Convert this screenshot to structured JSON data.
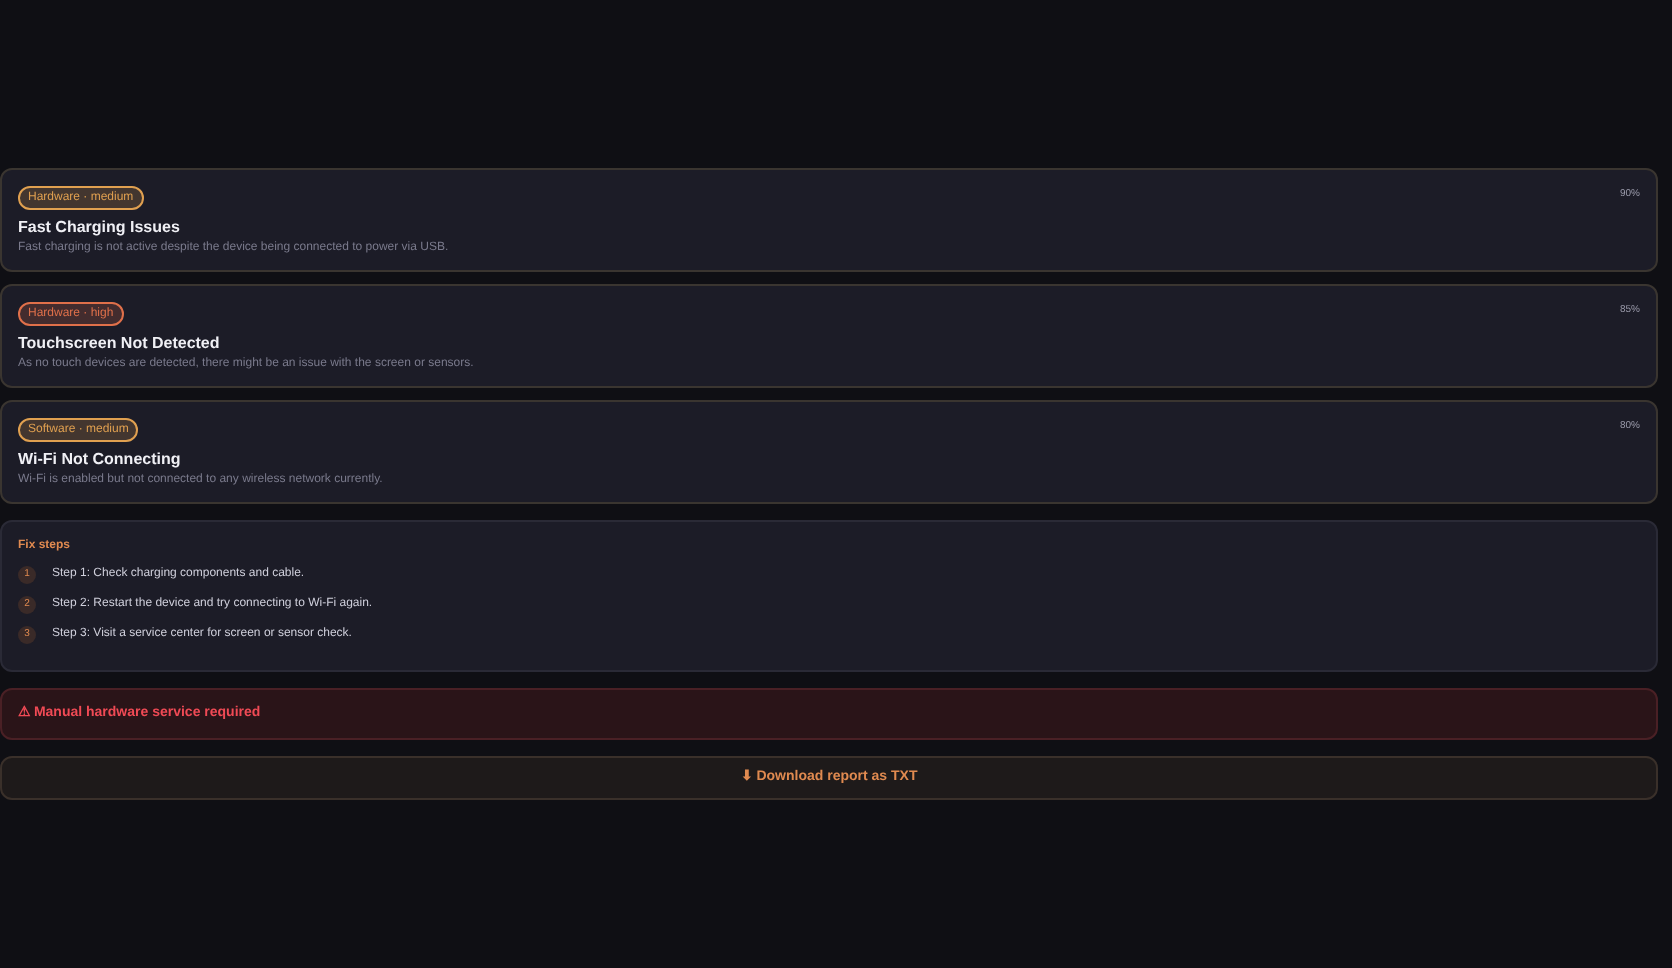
{
  "issues": [
    {
      "badge": "Hardware · medium",
      "color": "#e0a050",
      "title": "Fast Charging Issues",
      "description": "Fast charging is not active despite the device being connected to power via USB.",
      "confidence": "90%"
    },
    {
      "badge": "Hardware · high",
      "color": "#e0704a",
      "title": "Touchscreen Not Detected",
      "description": "As no touch devices are detected, there might be an issue with the screen or sensors.",
      "confidence": "85%"
    },
    {
      "badge": "Software · medium",
      "color": "#e0a050",
      "title": "Wi-Fi Not Connecting",
      "description": "Wi-Fi is enabled but not connected to any wireless network currently.",
      "confidence": "80%"
    }
  ],
  "fix_steps": {
    "title": "Fix steps",
    "steps": [
      {
        "number": "1",
        "text": "Step 1: Check charging components and cable."
      },
      {
        "number": "2",
        "text": "Step 2: Restart the device and try connecting to Wi-Fi again."
      },
      {
        "number": "3",
        "text": "Step 3: Visit a service center for screen or sensor check."
      }
    ]
  },
  "alert": {
    "text": "⚠ Manual hardware service required"
  },
  "download_button": {
    "label": "⬇ Download report as TXT"
  }
}
